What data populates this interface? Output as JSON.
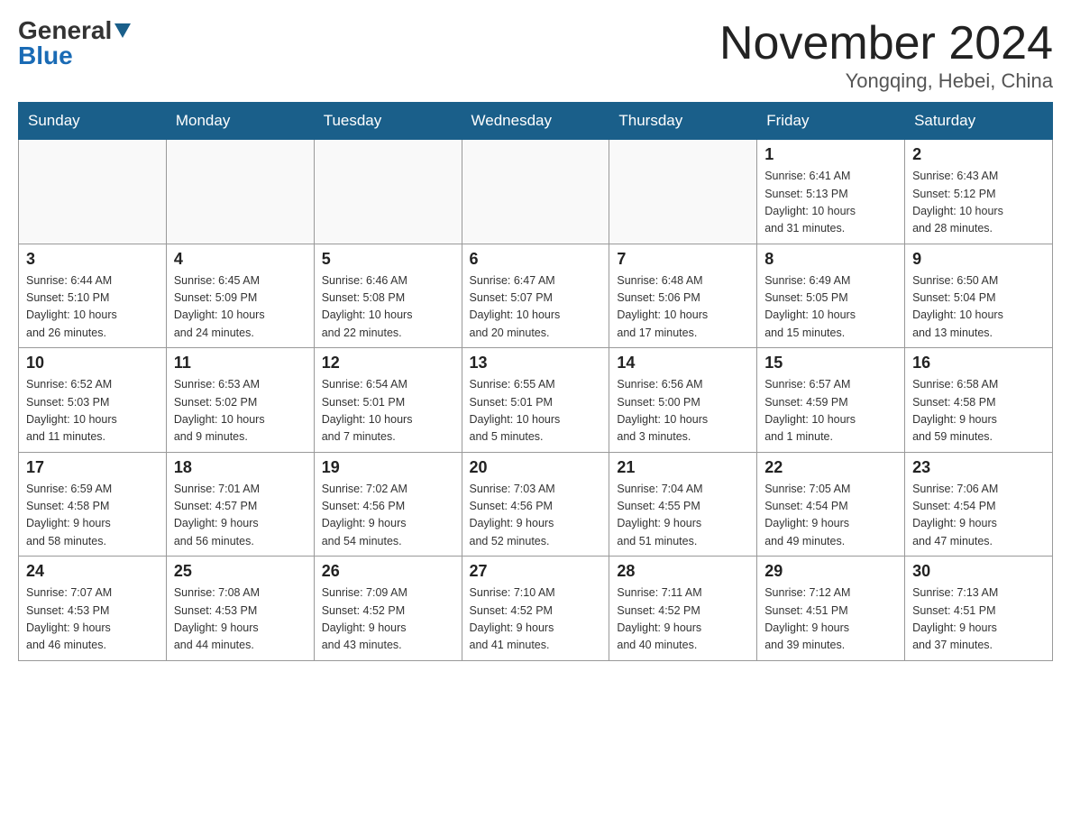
{
  "header": {
    "logo_general": "General",
    "logo_blue": "Blue",
    "month_year": "November 2024",
    "location": "Yongqing, Hebei, China"
  },
  "days_of_week": [
    "Sunday",
    "Monday",
    "Tuesday",
    "Wednesday",
    "Thursday",
    "Friday",
    "Saturday"
  ],
  "weeks": [
    [
      {
        "day": "",
        "info": ""
      },
      {
        "day": "",
        "info": ""
      },
      {
        "day": "",
        "info": ""
      },
      {
        "day": "",
        "info": ""
      },
      {
        "day": "",
        "info": ""
      },
      {
        "day": "1",
        "info": "Sunrise: 6:41 AM\nSunset: 5:13 PM\nDaylight: 10 hours\nand 31 minutes."
      },
      {
        "day": "2",
        "info": "Sunrise: 6:43 AM\nSunset: 5:12 PM\nDaylight: 10 hours\nand 28 minutes."
      }
    ],
    [
      {
        "day": "3",
        "info": "Sunrise: 6:44 AM\nSunset: 5:10 PM\nDaylight: 10 hours\nand 26 minutes."
      },
      {
        "day": "4",
        "info": "Sunrise: 6:45 AM\nSunset: 5:09 PM\nDaylight: 10 hours\nand 24 minutes."
      },
      {
        "day": "5",
        "info": "Sunrise: 6:46 AM\nSunset: 5:08 PM\nDaylight: 10 hours\nand 22 minutes."
      },
      {
        "day": "6",
        "info": "Sunrise: 6:47 AM\nSunset: 5:07 PM\nDaylight: 10 hours\nand 20 minutes."
      },
      {
        "day": "7",
        "info": "Sunrise: 6:48 AM\nSunset: 5:06 PM\nDaylight: 10 hours\nand 17 minutes."
      },
      {
        "day": "8",
        "info": "Sunrise: 6:49 AM\nSunset: 5:05 PM\nDaylight: 10 hours\nand 15 minutes."
      },
      {
        "day": "9",
        "info": "Sunrise: 6:50 AM\nSunset: 5:04 PM\nDaylight: 10 hours\nand 13 minutes."
      }
    ],
    [
      {
        "day": "10",
        "info": "Sunrise: 6:52 AM\nSunset: 5:03 PM\nDaylight: 10 hours\nand 11 minutes."
      },
      {
        "day": "11",
        "info": "Sunrise: 6:53 AM\nSunset: 5:02 PM\nDaylight: 10 hours\nand 9 minutes."
      },
      {
        "day": "12",
        "info": "Sunrise: 6:54 AM\nSunset: 5:01 PM\nDaylight: 10 hours\nand 7 minutes."
      },
      {
        "day": "13",
        "info": "Sunrise: 6:55 AM\nSunset: 5:01 PM\nDaylight: 10 hours\nand 5 minutes."
      },
      {
        "day": "14",
        "info": "Sunrise: 6:56 AM\nSunset: 5:00 PM\nDaylight: 10 hours\nand 3 minutes."
      },
      {
        "day": "15",
        "info": "Sunrise: 6:57 AM\nSunset: 4:59 PM\nDaylight: 10 hours\nand 1 minute."
      },
      {
        "day": "16",
        "info": "Sunrise: 6:58 AM\nSunset: 4:58 PM\nDaylight: 9 hours\nand 59 minutes."
      }
    ],
    [
      {
        "day": "17",
        "info": "Sunrise: 6:59 AM\nSunset: 4:58 PM\nDaylight: 9 hours\nand 58 minutes."
      },
      {
        "day": "18",
        "info": "Sunrise: 7:01 AM\nSunset: 4:57 PM\nDaylight: 9 hours\nand 56 minutes."
      },
      {
        "day": "19",
        "info": "Sunrise: 7:02 AM\nSunset: 4:56 PM\nDaylight: 9 hours\nand 54 minutes."
      },
      {
        "day": "20",
        "info": "Sunrise: 7:03 AM\nSunset: 4:56 PM\nDaylight: 9 hours\nand 52 minutes."
      },
      {
        "day": "21",
        "info": "Sunrise: 7:04 AM\nSunset: 4:55 PM\nDaylight: 9 hours\nand 51 minutes."
      },
      {
        "day": "22",
        "info": "Sunrise: 7:05 AM\nSunset: 4:54 PM\nDaylight: 9 hours\nand 49 minutes."
      },
      {
        "day": "23",
        "info": "Sunrise: 7:06 AM\nSunset: 4:54 PM\nDaylight: 9 hours\nand 47 minutes."
      }
    ],
    [
      {
        "day": "24",
        "info": "Sunrise: 7:07 AM\nSunset: 4:53 PM\nDaylight: 9 hours\nand 46 minutes."
      },
      {
        "day": "25",
        "info": "Sunrise: 7:08 AM\nSunset: 4:53 PM\nDaylight: 9 hours\nand 44 minutes."
      },
      {
        "day": "26",
        "info": "Sunrise: 7:09 AM\nSunset: 4:52 PM\nDaylight: 9 hours\nand 43 minutes."
      },
      {
        "day": "27",
        "info": "Sunrise: 7:10 AM\nSunset: 4:52 PM\nDaylight: 9 hours\nand 41 minutes."
      },
      {
        "day": "28",
        "info": "Sunrise: 7:11 AM\nSunset: 4:52 PM\nDaylight: 9 hours\nand 40 minutes."
      },
      {
        "day": "29",
        "info": "Sunrise: 7:12 AM\nSunset: 4:51 PM\nDaylight: 9 hours\nand 39 minutes."
      },
      {
        "day": "30",
        "info": "Sunrise: 7:13 AM\nSunset: 4:51 PM\nDaylight: 9 hours\nand 37 minutes."
      }
    ]
  ]
}
